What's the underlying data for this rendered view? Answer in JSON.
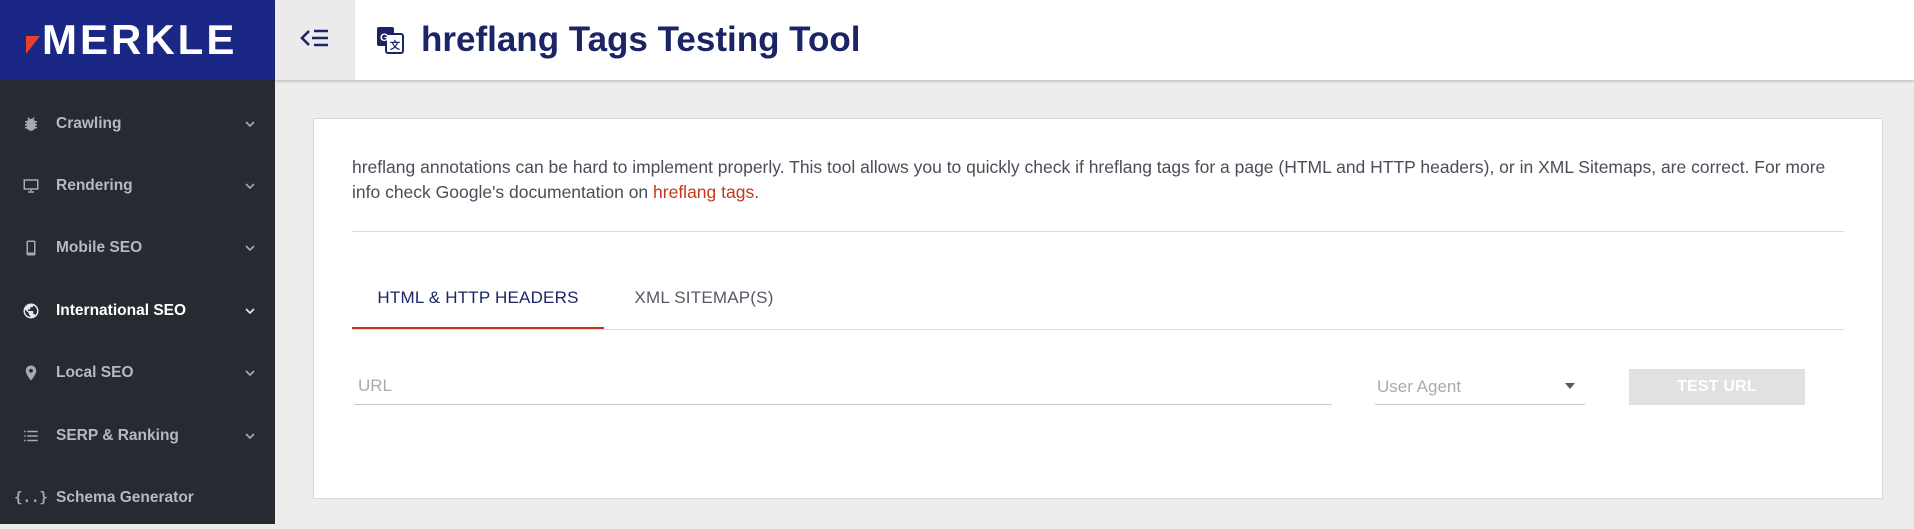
{
  "brand": {
    "logo_text": "MERKLE",
    "colors": {
      "sidebar": "#272a31",
      "logo_bg": "#1b2785",
      "accent": "#c4391c",
      "title": "#1b2566"
    }
  },
  "sidebar": {
    "items": [
      {
        "label": "Crawling",
        "icon": "bug-icon",
        "active": false,
        "chevron": true
      },
      {
        "label": "Rendering",
        "icon": "monitor-icon",
        "active": false,
        "chevron": true
      },
      {
        "label": "Mobile SEO",
        "icon": "phone-icon",
        "active": false,
        "chevron": true
      },
      {
        "label": "International SEO",
        "icon": "globe-icon",
        "active": true,
        "chevron": true
      },
      {
        "label": "Local SEO",
        "icon": "map-pin-icon",
        "active": false,
        "chevron": true
      },
      {
        "label": "SERP & Ranking",
        "icon": "list-icon",
        "active": false,
        "chevron": true
      },
      {
        "label": "Schema Generator",
        "icon": "code-braces-icon",
        "active": false,
        "chevron": false
      }
    ]
  },
  "header": {
    "menu_toggle_icon": "menu-collapse-icon",
    "title_icon": "translate-icon",
    "title": "hreflang Tags Testing Tool"
  },
  "main": {
    "intro_text": "hreflang annotations can be hard to implement properly. This tool allows you to quickly check if hreflang tags for a page (HTML and HTTP headers), or in XML Sitemaps, are correct. For more info check Google's documentation on ",
    "intro_link": "hreflang tags",
    "intro_end": ".",
    "tabs": [
      {
        "label": "HTML & HTTP HEADERS",
        "active": true
      },
      {
        "label": "XML SITEMAP(S)",
        "active": false
      }
    ],
    "url_placeholder": "URL",
    "user_agent_label": "User Agent",
    "test_button": "TEST URL"
  }
}
